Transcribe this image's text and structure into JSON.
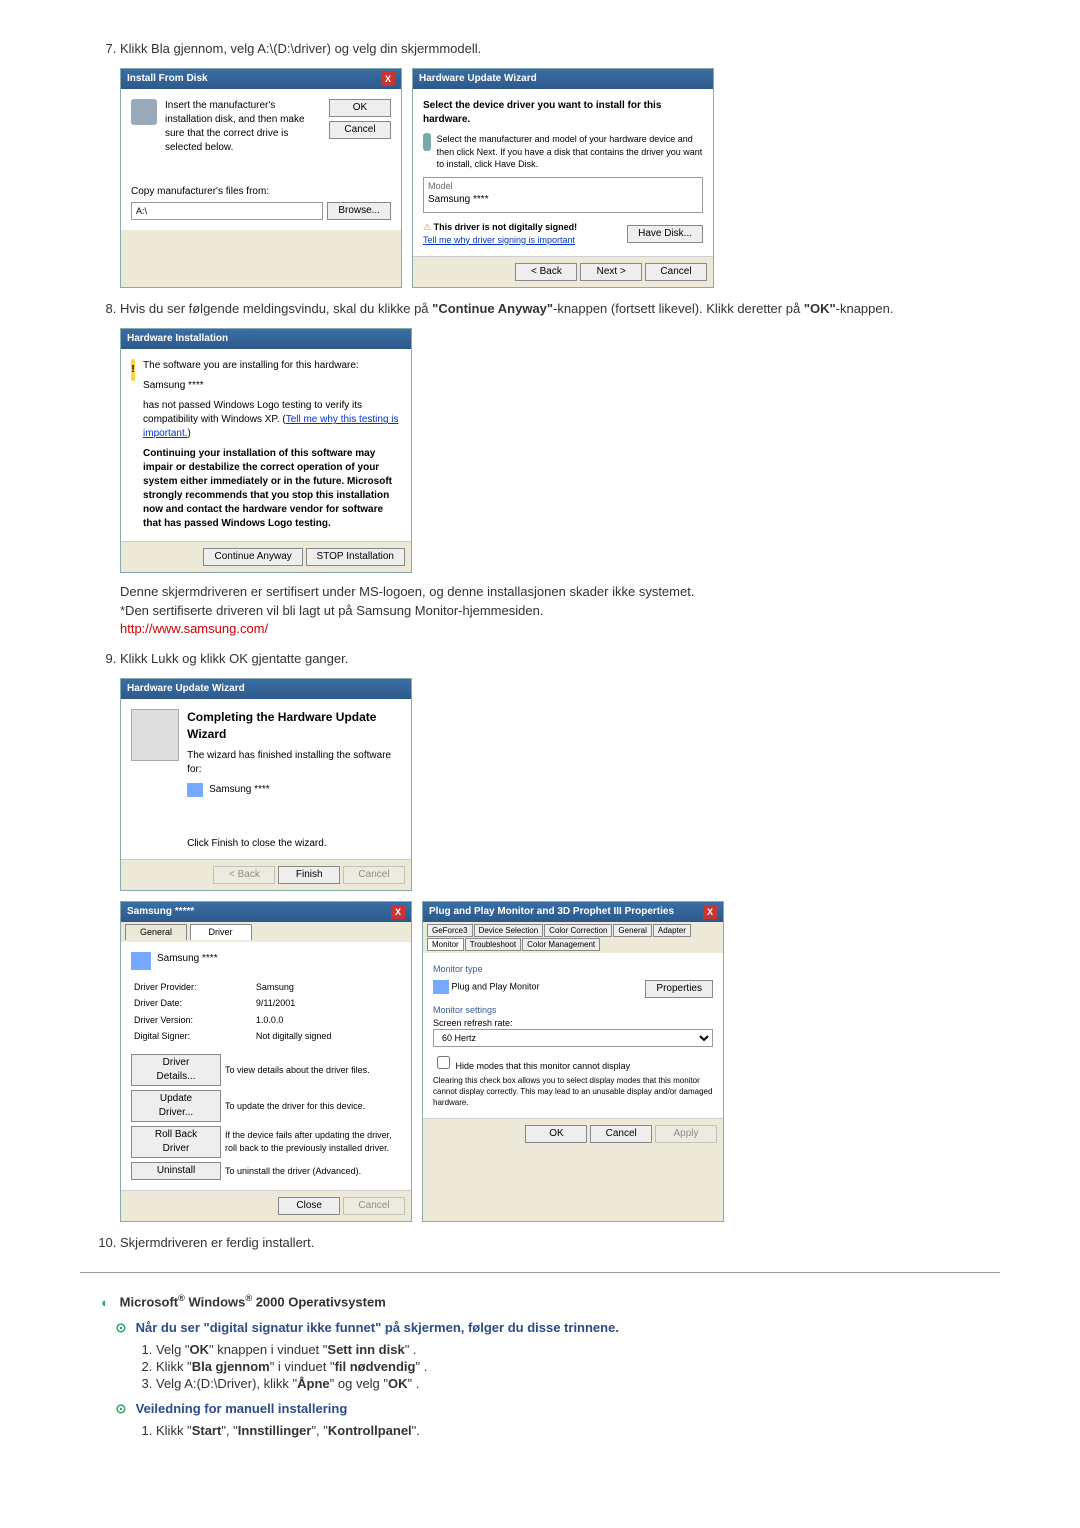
{
  "steps": {
    "s7": "Klikk Bla gjennom, velg A:\\(D:\\driver) og velg din skjermmodell.",
    "s8_a": "Hvis du ser følgende meldingsvindu, skal du klikke på ",
    "s8_b": "\"Continue Anyway\"",
    "s8_c": "-knappen (fortsett likevel). Klikk deretter på ",
    "s8_d": "\"OK\"",
    "s8_e": "-knappen.",
    "s8_note1": "Denne skjermdriveren er sertifisert under MS-logoen, og denne installasjonen skader ikke systemet.",
    "s8_note2": "*Den sertifiserte driveren vil bli lagt ut på Samsung Monitor-hjemmesiden.",
    "s8_link": "http://www.samsung.com/",
    "s9": "Klikk Lukk og klikk OK gjentatte ganger.",
    "s10": "Skjermdriveren er ferdig installert."
  },
  "installFromDisk": {
    "title": "Install From Disk",
    "instruction": "Insert the manufacturer's installation disk, and then make sure that the correct drive is selected below.",
    "ok": "OK",
    "cancel": "Cancel",
    "copyFrom": "Copy manufacturer's files from:",
    "pathValue": "A:\\",
    "browse": "Browse..."
  },
  "hwUpdate": {
    "title": "Hardware Update Wizard",
    "selectDriver": "Select the device driver you want to install for this hardware.",
    "manuInstr": "Select the manufacturer and model of your hardware device and then click Next. If you have a disk that contains the driver you want to install, click Have Disk.",
    "modelLabel": "Model",
    "modelValue": "Samsung ****",
    "notSigned": "This driver is not digitally signed!",
    "tellMe": "Tell me why driver signing is important",
    "haveDisk": "Have Disk...",
    "back": "< Back",
    "next": "Next >",
    "cancel": "Cancel"
  },
  "hwInstall": {
    "title": "Hardware Installation",
    "line1": "The software you are installing for this hardware:",
    "name": "Samsung ****",
    "line2a": "has not passed Windows Logo testing to verify its compatibility with Windows XP. (",
    "line2link": "Tell me why this testing is important.",
    "line2b": ")",
    "warn": "Continuing your installation of this software may impair or destabilize the correct operation of your system either immediately or in the future. Microsoft strongly recommends that you stop this installation now and contact the hardware vendor for software that has passed Windows Logo testing.",
    "continue": "Continue Anyway",
    "stop": "STOP Installation"
  },
  "completing": {
    "title": "Hardware Update Wizard",
    "heading": "Completing the Hardware Update Wizard",
    "finishedFor": "The wizard has finished installing the software for:",
    "name": "Samsung ****",
    "clickFinish": "Click Finish to close the wizard.",
    "back": "< Back",
    "finish": "Finish",
    "cancel": "Cancel"
  },
  "props": {
    "title": "Samsung *****",
    "tabGeneral": "General",
    "tabDriver": "Driver",
    "name": "Samsung ****",
    "providerLabel": "Driver Provider:",
    "providerValue": "Samsung",
    "dateLabel": "Driver Date:",
    "dateValue": "9/11/2001",
    "versionLabel": "Driver Version:",
    "versionValue": "1.0.0.0",
    "signerLabel": "Digital Signer:",
    "signerValue": "Not digitally signed",
    "details": "Driver Details...",
    "detailsDesc": "To view details about the driver files.",
    "update": "Update Driver...",
    "updateDesc": "To update the driver for this device.",
    "rollback": "Roll Back Driver",
    "rollbackDesc": "If the device fails after updating the driver, roll back to the previously installed driver.",
    "uninstall": "Uninstall",
    "uninstallDesc": "To uninstall the driver (Advanced).",
    "close": "Close",
    "cancel": "Cancel"
  },
  "monitorProps": {
    "title": "Plug and Play Monitor and 3D Prophet III Properties",
    "tabs": [
      "GeForce3",
      "Device Selection",
      "Color Correction",
      "General",
      "Adapter",
      "Monitor",
      "Troubleshoot",
      "Color Management"
    ],
    "monitorType": "Monitor type",
    "pnp": "Plug and Play Monitor",
    "propsBtn": "Properties",
    "settings": "Monitor settings",
    "refreshLabel": "Screen refresh rate:",
    "refreshValue": "60 Hertz",
    "hideModes": "Hide modes that this monitor cannot display",
    "hideDesc": "Clearing this check box allows you to select display modes that this monitor cannot display correctly. This may lead to an unusable display and/or damaged hardware.",
    "ok": "OK",
    "cancel": "Cancel",
    "apply": "Apply"
  },
  "ms2000": {
    "heading_a": "Microsoft",
    "heading_b": " Windows",
    "heading_c": " 2000 Operativsystem",
    "sig_heading": "Når du ser \"digital signatur ikke funnet\" på skjermen, følger du disse trinnene.",
    "sig1_a": "Velg \"",
    "sig1_b": "OK",
    "sig1_c": "\" knappen i vinduet \"",
    "sig1_d": "Sett inn disk",
    "sig1_e": "\" .",
    "sig2_a": "Klikk \"",
    "sig2_b": "Bla gjennom",
    "sig2_c": "\" i vinduet \"",
    "sig2_d": "fil nødvendig",
    "sig2_e": "\" .",
    "sig3_a": "Velg A:(D:\\Driver), klikk \"",
    "sig3_b": "Åpne",
    "sig3_c": "\" og velg \"",
    "sig3_d": "OK",
    "sig3_e": "\" .",
    "manual_heading": "Veiledning for manuell installering",
    "man1_a": "Klikk \"",
    "man1_b": "Start",
    "man1_c": "\", \"",
    "man1_d": "Innstillinger",
    "man1_e": "\", \"",
    "man1_f": "Kontrollpanel",
    "man1_g": "\"."
  }
}
